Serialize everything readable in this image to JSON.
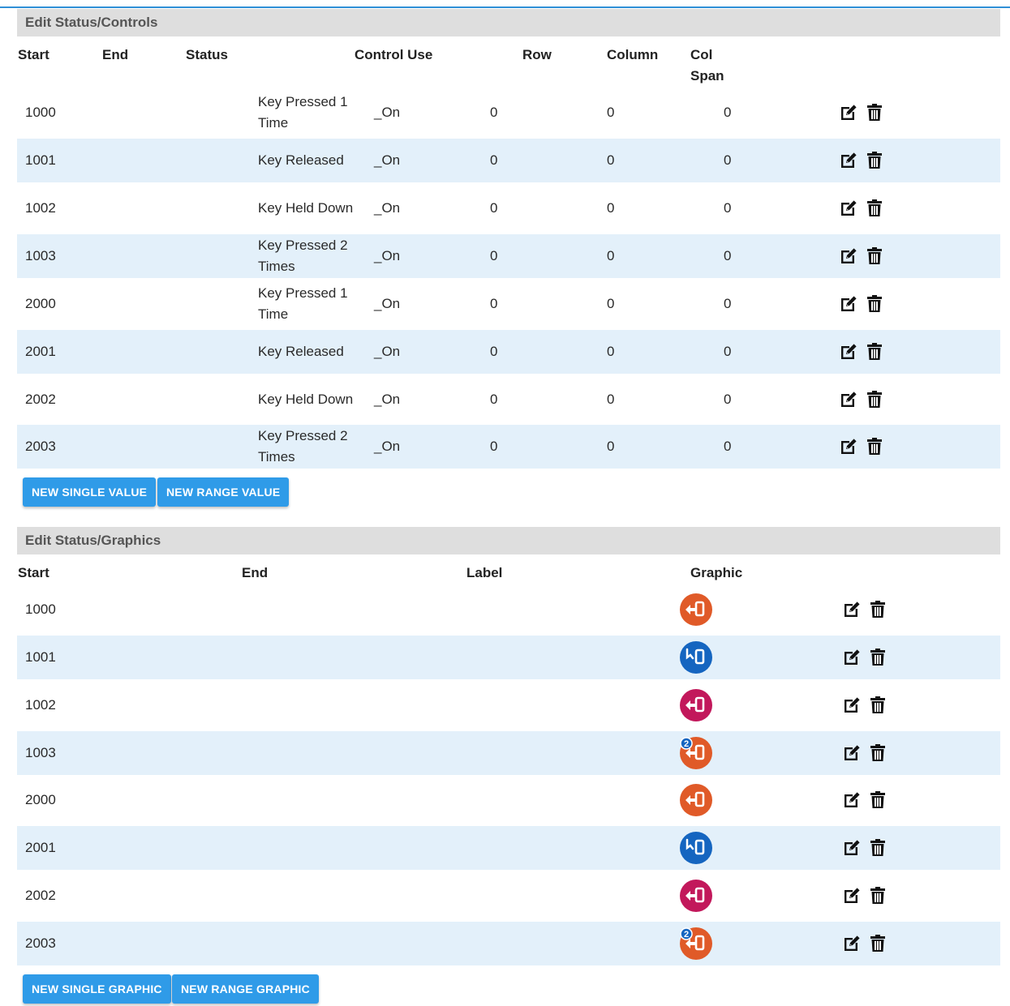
{
  "controls": {
    "title": "Edit Status/Controls",
    "headers": {
      "start": "Start",
      "end": "End",
      "status": "Status",
      "control_use": "Control Use",
      "row": "Row",
      "column": "Column",
      "col_span_1": "Col",
      "col_span_2": "Span"
    },
    "rows": [
      {
        "start": "1000",
        "status_line1": "Key Pressed 1",
        "status_line2": "Time",
        "control_use": "_On",
        "row": "0",
        "column": "0",
        "col_span": "0"
      },
      {
        "start": "1001",
        "status_line1": "Key Released",
        "status_line2": "",
        "control_use": "_On",
        "row": "0",
        "column": "0",
        "col_span": "0"
      },
      {
        "start": "1002",
        "status_line1": "Key Held Down",
        "status_line2": "",
        "control_use": "_On",
        "row": "0",
        "column": "0",
        "col_span": "0"
      },
      {
        "start": "1003",
        "status_line1": "Key Pressed 2",
        "status_line2": "Times",
        "control_use": "_On",
        "row": "0",
        "column": "0",
        "col_span": "0"
      },
      {
        "start": "2000",
        "status_line1": "Key Pressed 1",
        "status_line2": "Time",
        "control_use": "_On",
        "row": "0",
        "column": "0",
        "col_span": "0"
      },
      {
        "start": "2001",
        "status_line1": "Key Released",
        "status_line2": "",
        "control_use": "_On",
        "row": "0",
        "column": "0",
        "col_span": "0"
      },
      {
        "start": "2002",
        "status_line1": "Key Held Down",
        "status_line2": "",
        "control_use": "_On",
        "row": "0",
        "column": "0",
        "col_span": "0"
      },
      {
        "start": "2003",
        "status_line1": "Key Pressed 2",
        "status_line2": "Times",
        "control_use": "_On",
        "row": "0",
        "column": "0",
        "col_span": "0"
      }
    ],
    "buttons": {
      "new_single": "NEW SINGLE VALUE",
      "new_range": "NEW RANGE VALUE"
    }
  },
  "graphics": {
    "title": "Edit Status/Graphics",
    "headers": {
      "start": "Start",
      "end": "End",
      "label": "Label",
      "graphic": "Graphic"
    },
    "rows": [
      {
        "start": "1000",
        "graphic": "key-pressed-icon",
        "color": "#e05a28"
      },
      {
        "start": "1001",
        "graphic": "key-released-icon",
        "color": "#1565c0"
      },
      {
        "start": "1002",
        "graphic": "key-held-icon",
        "color": "#c2185b"
      },
      {
        "start": "1003",
        "graphic": "key-pressed-twice-icon",
        "color": "#e05a28",
        "badge": "2"
      },
      {
        "start": "2000",
        "graphic": "key-pressed-icon",
        "color": "#e05a28"
      },
      {
        "start": "2001",
        "graphic": "key-released-icon",
        "color": "#1565c0"
      },
      {
        "start": "2002",
        "graphic": "key-held-icon",
        "color": "#c2185b"
      },
      {
        "start": "2003",
        "graphic": "key-pressed-twice-icon",
        "color": "#e05a28",
        "badge": "2"
      }
    ],
    "buttons": {
      "new_single": "NEW SINGLE GRAPHIC",
      "new_range": "NEW RANGE GRAPHIC"
    }
  },
  "colors": {
    "accent": "#2f9be8",
    "row_alt": "#e3f0fa",
    "header_bg": "#dedede"
  },
  "icons": {
    "edit": "edit-icon",
    "delete": "trash-icon"
  }
}
